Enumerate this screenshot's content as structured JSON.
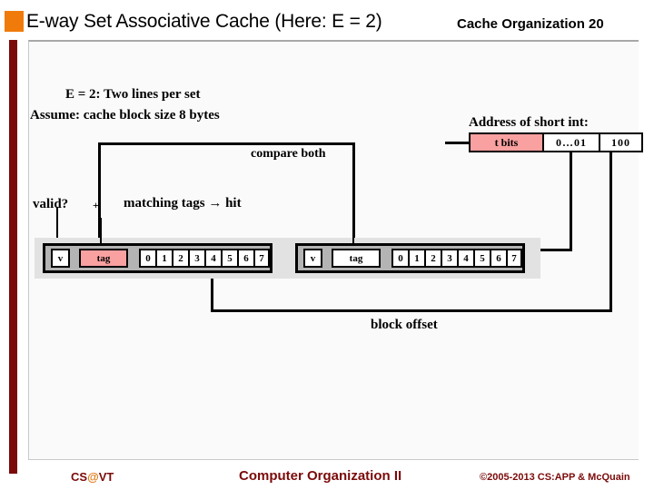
{
  "header": {
    "title": "E-way Set Associative Cache (Here: E = 2)",
    "subtitle": "Cache Organization 20"
  },
  "notes": {
    "line1": "E = 2: Two lines per set",
    "line2": "Assume: cache block size 8 bytes"
  },
  "address": {
    "caption": "Address of short int:",
    "fields": [
      {
        "label": "t bits",
        "highlight": true
      },
      {
        "label": "0…01",
        "highlight": false
      },
      {
        "label": "100",
        "highlight": false
      }
    ]
  },
  "labels": {
    "compare_both": "compare both",
    "valid": "valid?",
    "plus": "+",
    "matching": "matching tags → hit",
    "block_offset": "block offset"
  },
  "cache_set": {
    "lines": [
      {
        "valid": "v",
        "tag": "tag",
        "tag_highlight": true,
        "bytes": [
          "0",
          "1",
          "2",
          "3",
          "4",
          "5",
          "6",
          "7"
        ]
      },
      {
        "valid": "v",
        "tag": "tag",
        "tag_highlight": false,
        "bytes": [
          "0",
          "1",
          "2",
          "3",
          "4",
          "5",
          "6",
          "7"
        ]
      }
    ]
  },
  "footer": {
    "left_pre": "CS",
    "left_at": "@",
    "left_post": "VT",
    "center": "Computer Organization II",
    "right": "©2005-2013 CS:APP & McQuain"
  },
  "colors": {
    "accent_orange": "#F07B0A",
    "bar_dark_red": "#7B0A0A",
    "highlight_pink": "#F9A0A0",
    "panel_bg": "#FAFAFA",
    "set_strip": "#E2E2E2"
  }
}
